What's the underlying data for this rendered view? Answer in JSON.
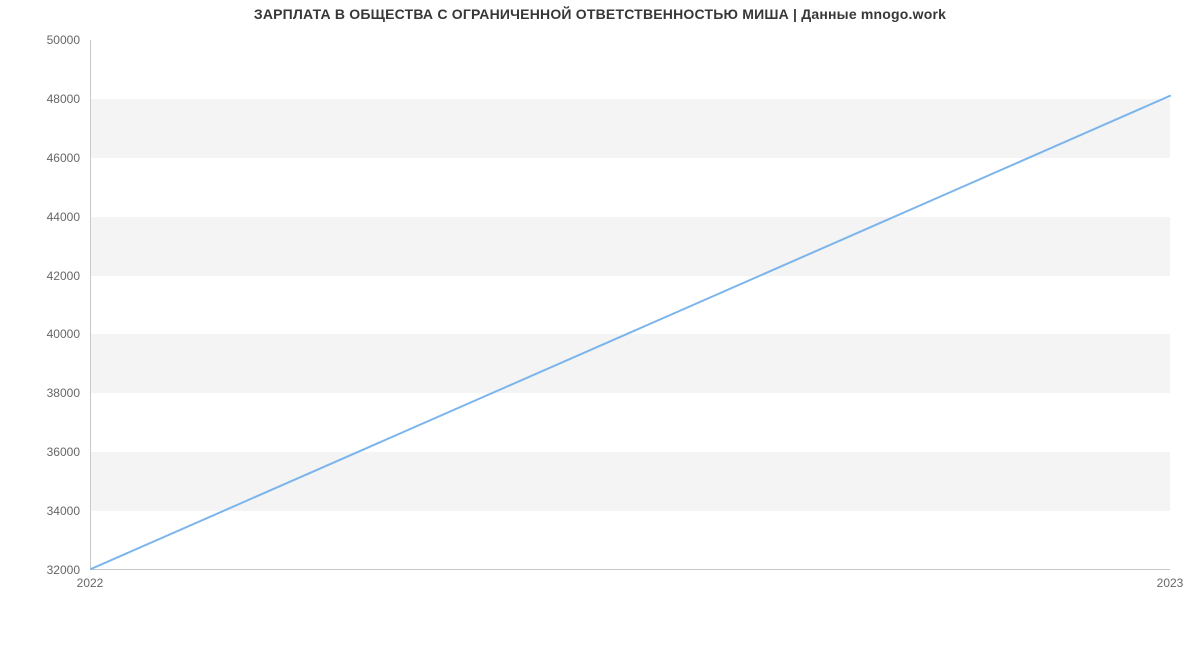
{
  "chart_data": {
    "type": "line",
    "title": "ЗАРПЛАТА В ОБЩЕСТВА С ОГРАНИЧЕННОЙ ОТВЕТСТВЕННОСТЬЮ МИША | Данные mnogo.work",
    "xlabel": "",
    "ylabel": "",
    "x": [
      2022,
      2023
    ],
    "values": [
      32000,
      48100
    ],
    "x_ticks": [
      "2022",
      "2023"
    ],
    "y_ticks": [
      32000,
      34000,
      36000,
      38000,
      40000,
      42000,
      44000,
      46000,
      48000,
      50000
    ],
    "ylim": [
      32000,
      50000
    ],
    "xlim": [
      2022,
      2023
    ],
    "line_color": "#7cb5ec",
    "band_color": "#f4f4f4"
  }
}
